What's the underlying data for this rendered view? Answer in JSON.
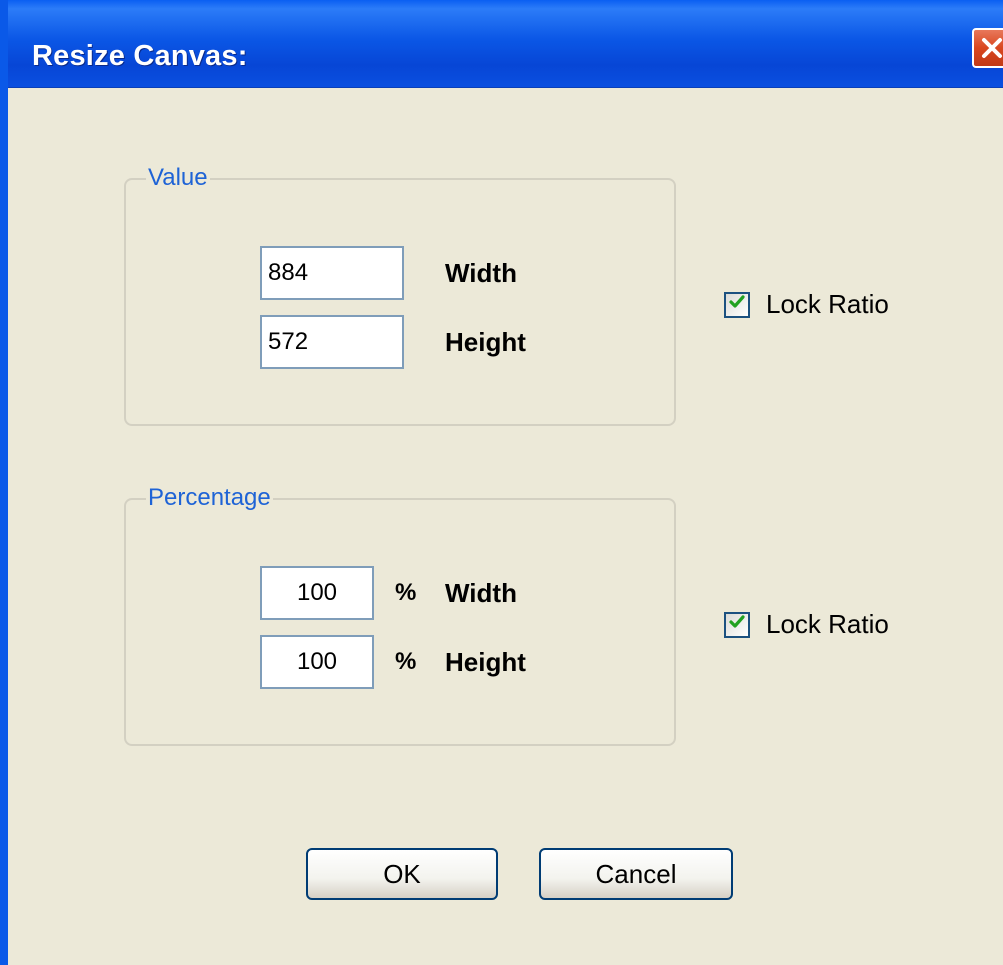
{
  "window": {
    "title": "Resize Canvas:"
  },
  "icons": {
    "close": "close-icon",
    "check": "checkmark-icon"
  },
  "colors": {
    "titlebar": "#0A59E8",
    "close_button": "#D9471F",
    "group_legend": "#1E63D6",
    "check": "#21A121"
  },
  "value_group": {
    "legend": "Value",
    "width_value": "884",
    "width_label": "Width",
    "height_value": "572",
    "height_label": "Height",
    "lock_ratio_label": "Lock Ratio",
    "lock_ratio_checked": true
  },
  "percentage_group": {
    "legend": "Percentage",
    "width_value": "100",
    "width_unit": "%",
    "width_label": "Width",
    "height_value": "100",
    "height_unit": "%",
    "height_label": "Height",
    "lock_ratio_label": "Lock Ratio",
    "lock_ratio_checked": true
  },
  "buttons": {
    "ok_label": "OK",
    "cancel_label": "Cancel"
  }
}
